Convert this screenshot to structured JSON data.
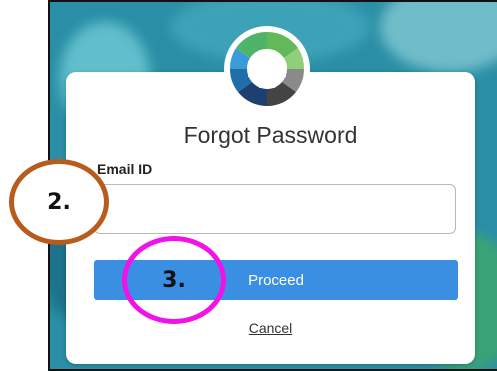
{
  "dialog": {
    "title": "Forgot Password",
    "email_label": "Email ID",
    "email_value": "",
    "email_placeholder": "",
    "proceed_label": "Proceed",
    "cancel_label": "Cancel"
  },
  "annotations": [
    {
      "label": "2.",
      "color": "#b85c1e"
    },
    {
      "label": "3.",
      "color": "#f012e8"
    }
  ],
  "colors": {
    "primary_button": "#3b8fe3",
    "background": "#2a8fa6",
    "logo_blue": "#1e6fa8",
    "logo_green": "#63b85a",
    "logo_gray": "#555555"
  },
  "logo_icon": "medical-cross-logo"
}
